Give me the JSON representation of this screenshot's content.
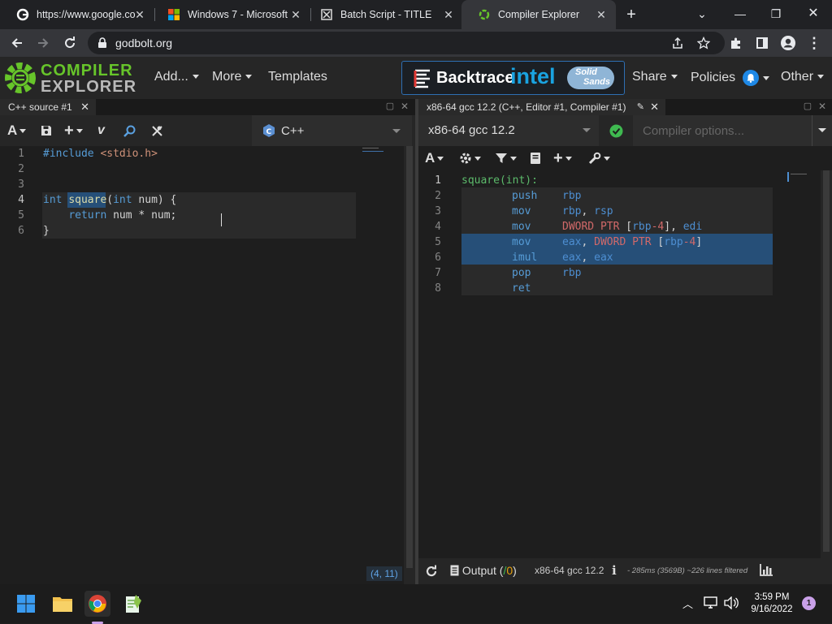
{
  "browser": {
    "tabs": [
      {
        "title": "https://www.google.co",
        "icon": "google-icon"
      },
      {
        "title": "Windows 7 - Microsoft",
        "icon": "microsoft-icon"
      },
      {
        "title": "Batch Script - TITLE",
        "icon": "batch-script-icon"
      },
      {
        "title": "Compiler Explorer",
        "icon": "compiler-explorer-icon",
        "active": true
      }
    ],
    "url": "godbolt.org"
  },
  "navbar": {
    "logo_line1": "COMPILER",
    "logo_line2": "EXPLORER",
    "add_label": "Add...",
    "more_label": "More",
    "templates_label": "Templates",
    "sponsor_backtrace": "Backtrace",
    "sponsor_intel": "intel",
    "sponsor_solid": "Solid",
    "sponsor_sands": "Sands",
    "share_label": "Share",
    "policies_label": "Policies",
    "other_label": "Other"
  },
  "editor": {
    "tab_title": "C++ source #1",
    "language": "C++",
    "line_numbers": [
      "1",
      "2",
      "3",
      "4",
      "5",
      "6"
    ],
    "cursor_position": "(4, 11)",
    "code": {
      "line1_directive": "#include",
      "line1_header": " <stdio.h>",
      "line4_type": "int",
      "line4_func": "square",
      "line4_paren": "(",
      "line4_argtype": "int",
      "line4_rest": " num) {",
      "line5_indent": "    ",
      "line5_kw": "return",
      "line5_rest": " num * num;",
      "line6": "}"
    }
  },
  "compiler": {
    "tab_title": "x86-64 gcc 12.2 (C++, Editor #1, Compiler #1)",
    "name": "x86-64 gcc 12.2",
    "options_placeholder": "Compiler options...",
    "line_numbers": [
      "1",
      "2",
      "3",
      "4",
      "5",
      "6",
      "7",
      "8"
    ],
    "asm": [
      {
        "label": "square(int):"
      },
      {
        "op": "push",
        "args": [
          {
            "t": "reg",
            "v": "rbp"
          }
        ]
      },
      {
        "op": "mov",
        "args": [
          {
            "t": "reg",
            "v": "rbp"
          },
          {
            "t": "sep",
            "v": ", "
          },
          {
            "t": "reg",
            "v": "rsp"
          }
        ]
      },
      {
        "op": "mov",
        "args": [
          {
            "t": "kw",
            "v": "DWORD PTR "
          },
          {
            "t": "sep",
            "v": "["
          },
          {
            "t": "reg",
            "v": "rbp"
          },
          {
            "t": "kw",
            "v": "-4"
          },
          {
            "t": "sep",
            "v": "], "
          },
          {
            "t": "reg",
            "v": "edi"
          }
        ]
      },
      {
        "op": "mov",
        "args": [
          {
            "t": "reg",
            "v": "eax"
          },
          {
            "t": "sep",
            "v": ", "
          },
          {
            "t": "kw",
            "v": "DWORD PTR "
          },
          {
            "t": "sep",
            "v": "["
          },
          {
            "t": "reg",
            "v": "rbp"
          },
          {
            "t": "kw",
            "v": "-4"
          },
          {
            "t": "sep",
            "v": "]"
          }
        ]
      },
      {
        "op": "imul",
        "args": [
          {
            "t": "reg",
            "v": "eax"
          },
          {
            "t": "sep",
            "v": ", "
          },
          {
            "t": "reg",
            "v": "eax"
          }
        ]
      },
      {
        "op": "pop",
        "args": [
          {
            "t": "reg",
            "v": "rbp"
          }
        ]
      },
      {
        "op": "ret",
        "args": []
      }
    ],
    "output_label": "Output (",
    "output_ok": "/",
    "output_count": "0",
    "output_close": ")",
    "status_compiler": "x86-64 gcc 12.2",
    "status_stats": "- 285ms (3569B) ~226 lines filtered"
  },
  "taskbar": {
    "time": "3:59 PM",
    "date": "9/16/2022",
    "notification_count": "1"
  },
  "colors": {
    "accent_blue": "#1e88e5",
    "ce_green": "#67c52a",
    "highlight_line": "#264f78"
  }
}
